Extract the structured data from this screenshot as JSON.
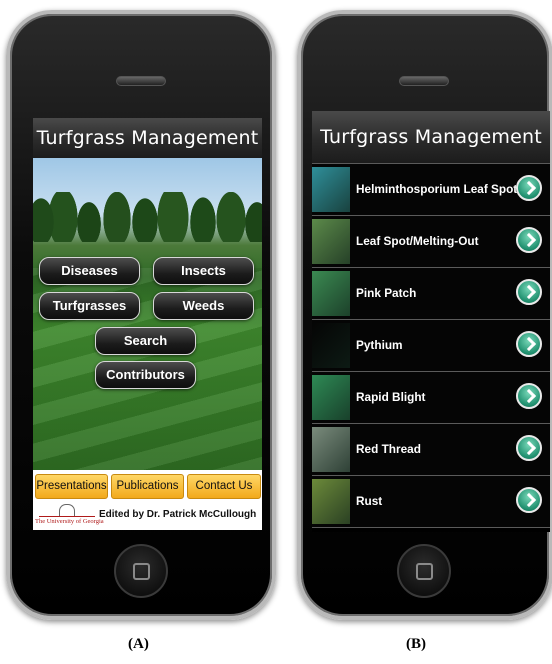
{
  "panel_a": {
    "app_title": "Turfgrass Management",
    "nav_buttons": [
      "Diseases",
      "Insects",
      "Turfgrasses",
      "Weeds",
      "Search",
      "Contributors"
    ],
    "footer_buttons": [
      "Presentations",
      "Publications",
      "Contact Us"
    ],
    "logo_text": "The University of Georgia",
    "credit": "Edited by Dr. Patrick McCullough",
    "caption": "(A)"
  },
  "panel_b": {
    "app_title": "Turfgrass Management",
    "items": [
      {
        "label": "Helminthosporium Leaf Spot",
        "thumb_color": "#2f8f9a"
      },
      {
        "label": "Leaf Spot/Melting-Out",
        "thumb_color": "#5c8a4a"
      },
      {
        "label": "Pink Patch",
        "thumb_color": "#3b8a52"
      },
      {
        "label": "Pythium",
        "thumb_color": "#050505"
      },
      {
        "label": "Rapid Blight",
        "thumb_color": "#2e8a55"
      },
      {
        "label": "Red Thread",
        "thumb_color": "#7a8b7c"
      },
      {
        "label": "Rust",
        "thumb_color": "#6c8a3a"
      }
    ],
    "caption": "(B)"
  },
  "colors": {
    "footer_button": "#f2a91b",
    "chevron": "#1f8f6e",
    "logo_red": "#b01a1a"
  }
}
